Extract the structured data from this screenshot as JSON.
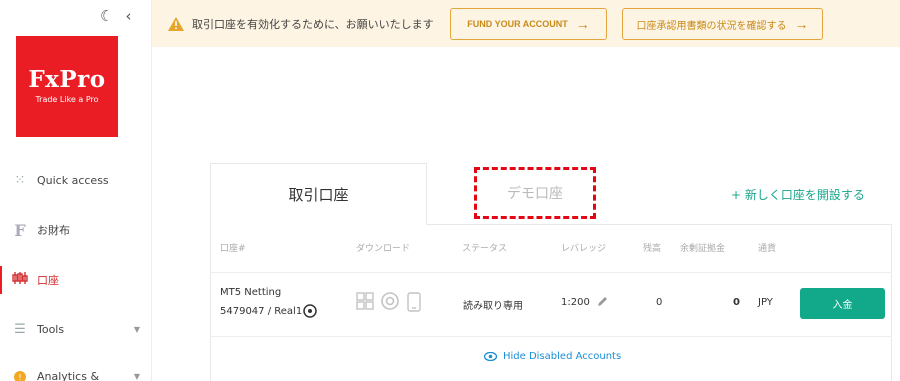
{
  "sidebar": {
    "logo_name": "FxPro",
    "logo_tagline": "Trade Like a Pro",
    "items": [
      {
        "label": "Quick access"
      },
      {
        "label": "お財布"
      },
      {
        "label": "口座"
      },
      {
        "label": "Tools"
      },
      {
        "label": "Analytics &"
      }
    ]
  },
  "banner": {
    "message": "取引口座を有効化するために、お願いいたします",
    "fund_button": "FUND YOUR ACCOUNT",
    "verify_button": "口座承認用書類の状況を確認する"
  },
  "tabs": {
    "live": "取引口座",
    "demo": "デモ口座",
    "new_account": "+ 新しく口座を開設する"
  },
  "table": {
    "headers": [
      "口座#",
      "ダウンロード",
      "ステータス",
      "レバレッジ",
      "残高",
      "余剰証拠金",
      "通貨"
    ],
    "row": {
      "platform": "MT5 Netting",
      "account": "5479047 / Real1",
      "status": "読み取り専用",
      "leverage": "1:200",
      "balance": "0",
      "free_margin": "0",
      "currency": "JPY",
      "deposit_button": "入金"
    },
    "hide_link": "Hide Disabled Accounts"
  },
  "colors": {
    "brand_red": "#ea1c24",
    "accent_green": "#12a98a",
    "banner_bg": "#fdf4e3",
    "banner_accent": "#e2a83f",
    "link_blue": "#1a8fd6"
  }
}
